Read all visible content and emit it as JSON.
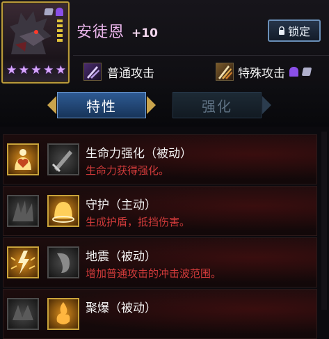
{
  "hero": {
    "name": "安徒恩",
    "level": "+10",
    "stars": [
      "★",
      "★",
      "★",
      "★",
      "★"
    ],
    "lock_label": "锁定"
  },
  "attacks": {
    "normal": "普通攻击",
    "special": "特殊攻击"
  },
  "tabs": [
    {
      "label": "特性",
      "active": true
    },
    {
      "label": "强化",
      "active": false
    }
  ],
  "skills": [
    {
      "name": "生命力强化（被动）",
      "desc": "生命力获得强化。",
      "icon1": "heart-shield-icon",
      "icon2": "sword-locked-icon"
    },
    {
      "name": "守护（主动）",
      "desc": "生成护盾，抵挡伤害。",
      "icon1": "dark-claw-icon",
      "icon2": "golden-dome-icon"
    },
    {
      "name": "地震（被动）",
      "desc": "增加普通攻击的冲击波范围。",
      "icon1": "lightning-burst-icon",
      "icon2": "dark-mask-icon"
    },
    {
      "name": "聚爆（被动）",
      "desc": "",
      "icon1": "dark-spikes-icon",
      "icon2": "flame-burst-icon"
    }
  ],
  "colors": {
    "accent_gold": "#c9a33a",
    "desc_red": "#cf3a3a",
    "tab_active": "#2e5a93",
    "star_purple": "#d8a6ff"
  }
}
